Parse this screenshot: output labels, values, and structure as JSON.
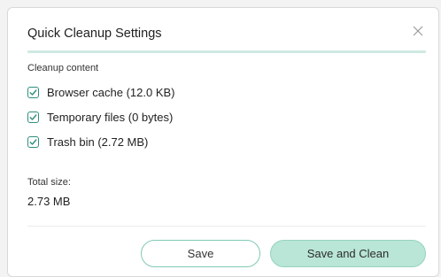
{
  "dialog": {
    "title": "Quick Cleanup Settings",
    "close_icon": "close-icon"
  },
  "cleanup": {
    "section_label": "Cleanup content",
    "options": [
      {
        "label": "Browser cache (12.0 KB)",
        "checked": true
      },
      {
        "label": "Temporary files (0 bytes)",
        "checked": true
      },
      {
        "label": "Trash bin (2.72 MB)",
        "checked": true
      }
    ]
  },
  "total": {
    "label": "Total size:",
    "value": "2.73 MB"
  },
  "footer": {
    "save_label": "Save",
    "save_and_clean_label": "Save and Clean"
  },
  "colors": {
    "accent": "#2f8f7d",
    "primary_button_bg": "#b9e6d6",
    "secondary_button_border": "#7fcab5",
    "title_rule": "#cfe9e3"
  }
}
